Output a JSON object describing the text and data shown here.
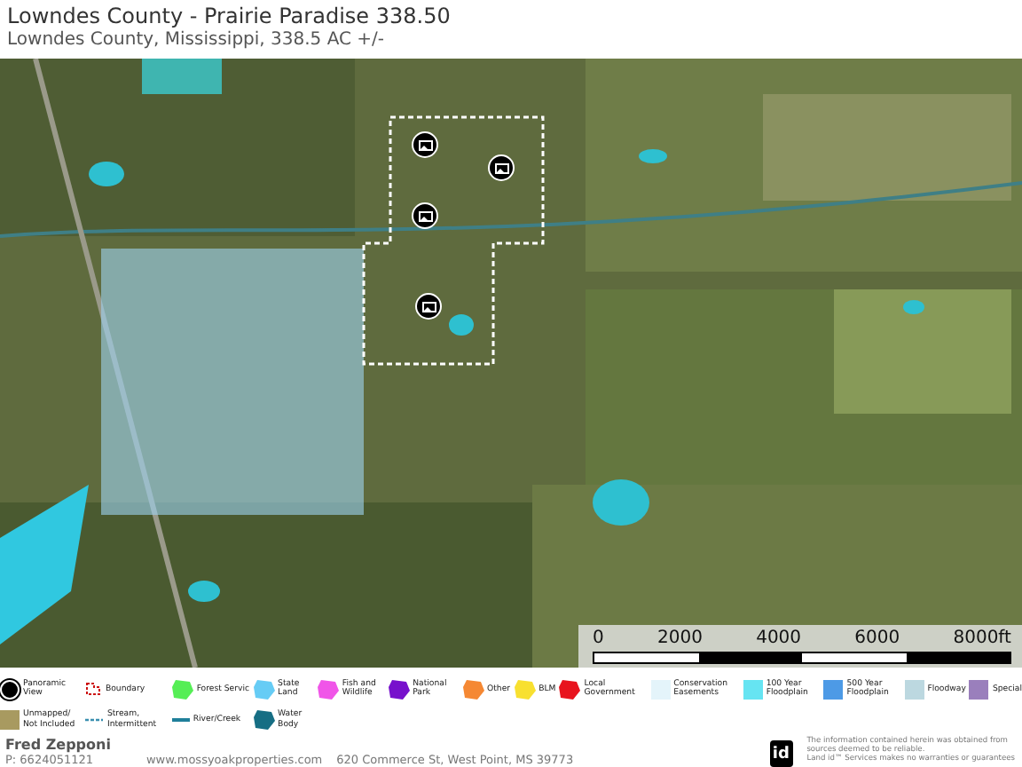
{
  "header": {
    "title": "Lowndes County - Prairie Paradise 338.50",
    "subtitle": "Lowndes County, Mississippi, 338.5 AC +/-"
  },
  "map": {
    "markers": [
      {
        "kind": "panoramic"
      },
      {
        "kind": "panoramic"
      },
      {
        "kind": "panoramic"
      },
      {
        "kind": "panoramic"
      }
    ],
    "scale_bar": {
      "ticks": [
        "0",
        "2000",
        "4000",
        "6000",
        "8000ft"
      ]
    }
  },
  "legend": [
    {
      "label": "Panoramic View",
      "kind": "icon",
      "color": "#000000"
    },
    {
      "label": "Boundary",
      "kind": "boundary",
      "color": "#cc1111"
    },
    {
      "label": "Forest Servic",
      "kind": "shape",
      "color": "#55ee55"
    },
    {
      "label": "State Land",
      "kind": "shape",
      "color": "#66ccf5"
    },
    {
      "label": "Fish and Wildlife",
      "kind": "shape",
      "color": "#f055e8"
    },
    {
      "label": "National Park",
      "kind": "shape",
      "color": "#7711cc"
    },
    {
      "label": "Other",
      "kind": "shape",
      "color": "#f58833"
    },
    {
      "label": "BLM",
      "kind": "shape",
      "color": "#f8e030"
    },
    {
      "label": "Local Government",
      "kind": "shape",
      "color": "#e8141e"
    },
    {
      "label": "Conservation Easements",
      "kind": "square",
      "color": "#e4f4fa"
    },
    {
      "label": "100 Year Floodplain",
      "kind": "square",
      "color": "#66e4f2"
    },
    {
      "label": "500 Year Floodplain",
      "kind": "square",
      "color": "#4d9ae6"
    },
    {
      "label": "Floodway",
      "kind": "square",
      "color": "#bcd8e0"
    },
    {
      "label": "Special",
      "kind": "square",
      "color": "#9a7fbc"
    },
    {
      "label": "Unmapped/ Not Included",
      "kind": "square",
      "color": "#a89a60"
    },
    {
      "label": "Stream, Intermittent",
      "kind": "dashed",
      "color": "#3a8fb0"
    },
    {
      "label": "River/Creek",
      "kind": "line",
      "color": "#1f7f9a"
    },
    {
      "label": "Water Body",
      "kind": "shape",
      "color": "#166e84"
    }
  ],
  "footer": {
    "agent": "Fred Zepponi",
    "phone": "P: 6624051121",
    "website": "www.mossyoakproperties.com",
    "address": "620 Commerce St, West Point, MS 39773",
    "logo": "id",
    "disclaimer": [
      "The information contained herein was obtained from",
      "sources deemed to be reliable.",
      "Land id™ Services makes no warranties or guarantees"
    ]
  }
}
